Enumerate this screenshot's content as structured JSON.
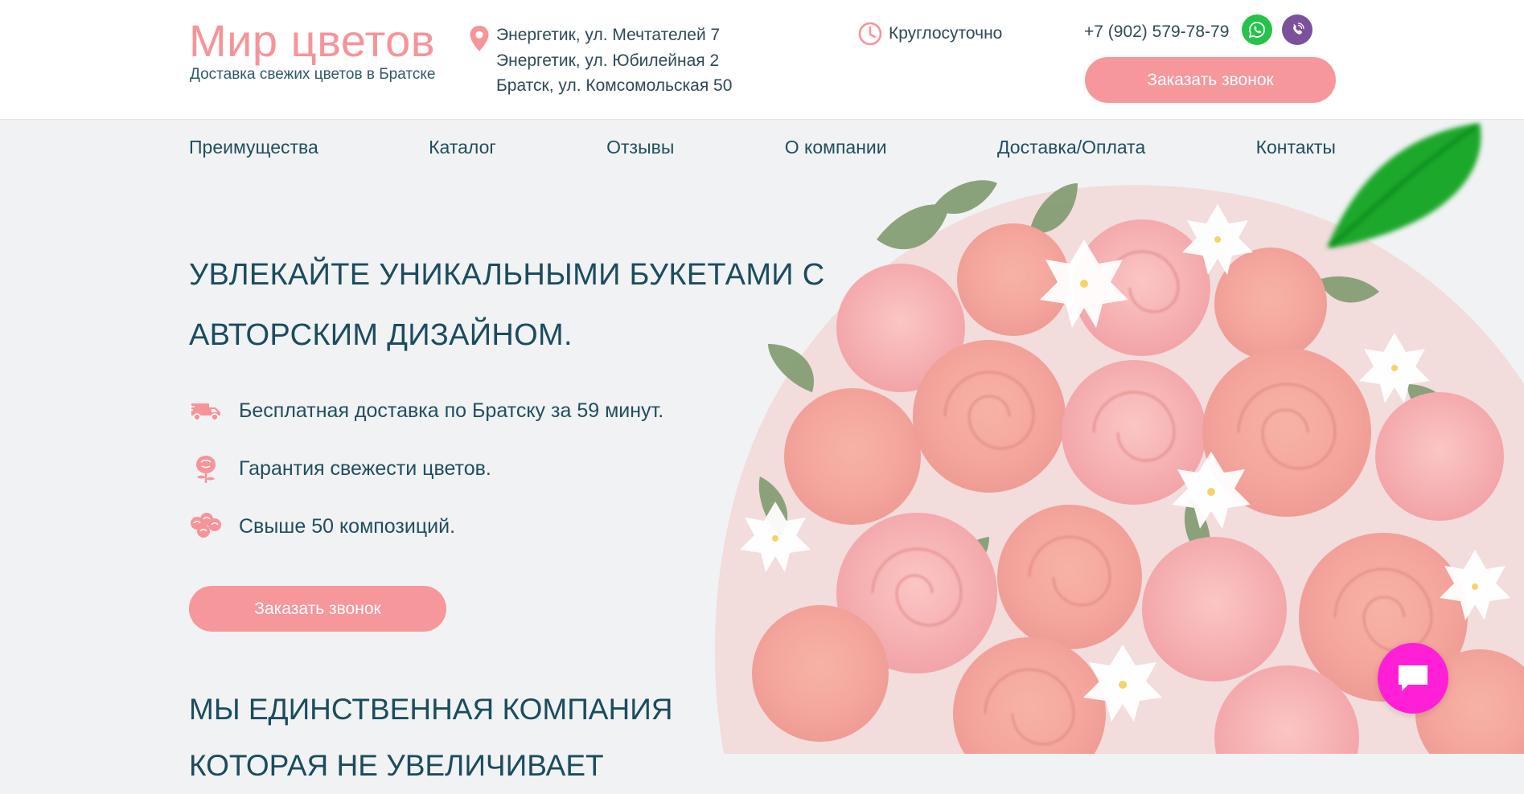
{
  "header": {
    "logo_title": "Мир цветов",
    "logo_subtitle": "Доставка свежих цветов в Братске",
    "addresses": [
      "Энергетик, ул. Мечтателей 7",
      "Энергетик, ул. Юбилейная 2",
      "Братск, ул. Комсомольская 50"
    ],
    "hours": "Круглосуточно",
    "phone": "+7 (902) 579-78-79",
    "callback_label": "Заказать звонок"
  },
  "nav": {
    "items": [
      "Преимущества",
      "Каталог",
      "Отзывы",
      "О компании",
      "Доставка/Оплата",
      "Контакты"
    ]
  },
  "hero": {
    "headline_lines": [
      "УВЛЕКАЙТЕ УНИКАЛЬНЫМИ БУКЕТАМИ С",
      "АВТОРСКИМ ДИЗАЙНОМ."
    ],
    "features": [
      {
        "icon": "truck-icon",
        "text": "Бесплатная доставка по Братску за 59 минут."
      },
      {
        "icon": "rose-icon",
        "text": "Гарантия свежести цветов."
      },
      {
        "icon": "bouquet-icon",
        "text": "Свыше 50 композиций."
      }
    ],
    "callback_label": "Заказать звонок",
    "subheadline_lines": [
      "МЫ ЕДИНСТВЕННАЯ КОМПАНИЯ",
      "КОТОРАЯ НЕ УВЕЛИЧИВАЕТ"
    ]
  },
  "colors": {
    "accent": "#f6979b",
    "text": "#1f4e5f",
    "whatsapp": "#25c34a",
    "viber": "#7b519d",
    "chat": "#ff1fd6"
  }
}
